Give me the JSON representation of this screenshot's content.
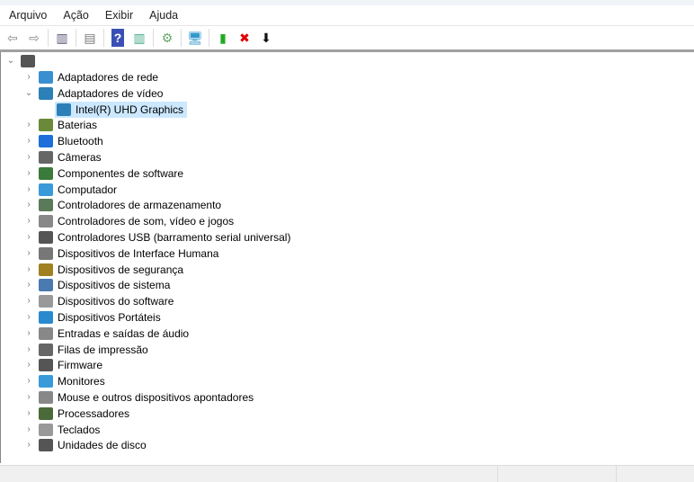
{
  "menu": [
    "Arquivo",
    "Ação",
    "Exibir",
    "Ajuda"
  ],
  "toolbar": [
    {
      "icon": "back-arrow-icon",
      "glyph": "⇦",
      "color": "#888"
    },
    {
      "icon": "forward-arrow-icon",
      "glyph": "⇨",
      "color": "#888"
    },
    {
      "sep": true
    },
    {
      "icon": "show-hide-console-tree-icon",
      "glyph": "▥",
      "color": "#557"
    },
    {
      "sep": true
    },
    {
      "icon": "properties-icon",
      "glyph": "▤",
      "color": "#777"
    },
    {
      "sep": true
    },
    {
      "icon": "help-icon",
      "glyph": "?",
      "color": "#fff",
      "bg": "#3a4fb5"
    },
    {
      "icon": "action-pane-icon",
      "glyph": "▥",
      "color": "#4a8"
    },
    {
      "sep": true
    },
    {
      "icon": "update-driver-icon",
      "glyph": "⚙",
      "color": "#6a6"
    },
    {
      "sep": true
    },
    {
      "icon": "scan-hardware-icon",
      "glyph": "🖥",
      "color": "#39c"
    },
    {
      "sep": true
    },
    {
      "icon": "add-device-icon",
      "glyph": "▮",
      "color": "#2a2"
    },
    {
      "icon": "uninstall-icon",
      "glyph": "✖",
      "color": "#d00"
    },
    {
      "icon": "download-icon",
      "glyph": "⬇",
      "color": "#111"
    }
  ],
  "tree": {
    "root": "",
    "items": [
      {
        "label": "Adaptadores de rede",
        "icon": "network-adapter-icon",
        "color": "#3a8fd0",
        "expanded": false
      },
      {
        "label": "Adaptadores de vídeo",
        "icon": "display-adapter-icon",
        "color": "#2d7fb8",
        "expanded": true,
        "children": [
          {
            "label": "Intel(R) UHD Graphics",
            "icon": "display-adapter-icon",
            "color": "#2d7fb8",
            "selected": true
          }
        ]
      },
      {
        "label": "Baterias",
        "icon": "battery-icon",
        "color": "#6a8a3a"
      },
      {
        "label": "Bluetooth",
        "icon": "bluetooth-icon",
        "color": "#1e6fd9"
      },
      {
        "label": "Câmeras",
        "icon": "camera-icon",
        "color": "#666"
      },
      {
        "label": "Componentes de software",
        "icon": "software-component-icon",
        "color": "#3a7a3a"
      },
      {
        "label": "Computador",
        "icon": "computer-icon",
        "color": "#3a9ad9"
      },
      {
        "label": "Controladores de armazenamento",
        "icon": "storage-controller-icon",
        "color": "#5a7a5a"
      },
      {
        "label": "Controladores de som, vídeo e jogos",
        "icon": "speaker-icon",
        "color": "#888"
      },
      {
        "label": "Controladores USB (barramento serial universal)",
        "icon": "usb-icon",
        "color": "#555"
      },
      {
        "label": "Dispositivos de Interface Humana",
        "icon": "hid-icon",
        "color": "#777"
      },
      {
        "label": "Dispositivos de segurança",
        "icon": "security-device-icon",
        "color": "#a08020"
      },
      {
        "label": "Dispositivos de sistema",
        "icon": "system-device-icon",
        "color": "#4a7ab0"
      },
      {
        "label": "Dispositivos do software",
        "icon": "software-device-icon",
        "color": "#999"
      },
      {
        "label": "Dispositivos Portáteis",
        "icon": "portable-device-icon",
        "color": "#2a8ad0"
      },
      {
        "label": "Entradas e saídas de áudio",
        "icon": "audio-io-icon",
        "color": "#888"
      },
      {
        "label": "Filas de impressão",
        "icon": "printer-icon",
        "color": "#666"
      },
      {
        "label": "Firmware",
        "icon": "firmware-icon",
        "color": "#555"
      },
      {
        "label": "Monitores",
        "icon": "monitor-icon",
        "color": "#3a9ad9"
      },
      {
        "label": "Mouse e outros dispositivos apontadores",
        "icon": "mouse-icon",
        "color": "#888"
      },
      {
        "label": "Processadores",
        "icon": "processor-icon",
        "color": "#4a6a3a"
      },
      {
        "label": "Teclados",
        "icon": "keyboard-icon",
        "color": "#999"
      },
      {
        "label": "Unidades de disco",
        "icon": "disk-drive-icon",
        "color": "#555"
      }
    ]
  }
}
